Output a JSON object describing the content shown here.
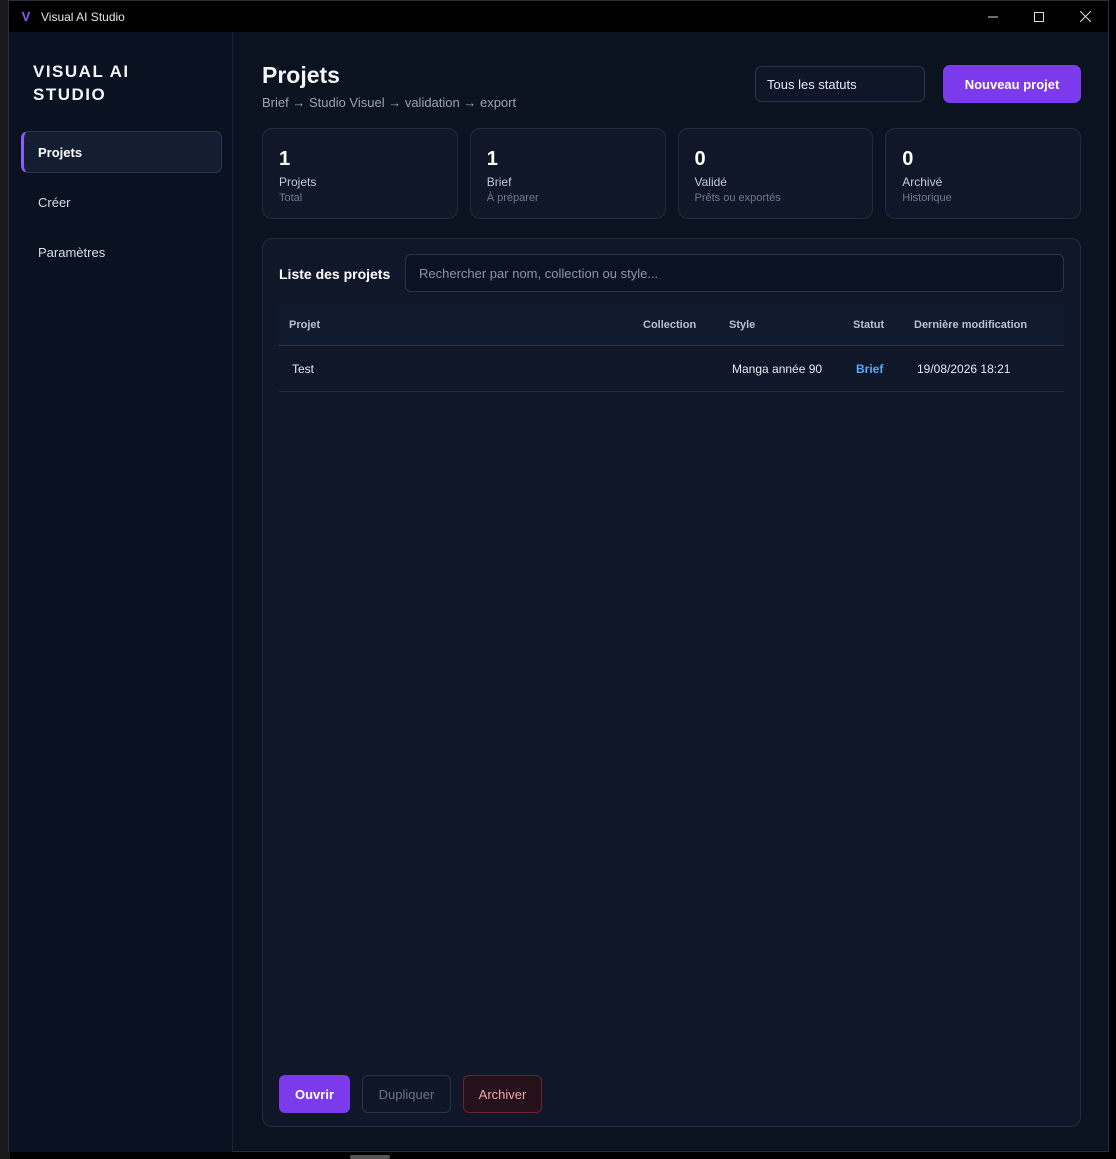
{
  "window": {
    "title": "Visual AI Studio",
    "app_icon": "V",
    "controls": [
      "minimize",
      "maximize",
      "close"
    ]
  },
  "sidebar": {
    "brand": "VISUAL AI STUDIO",
    "items": [
      {
        "label": "Projets",
        "active": true
      },
      {
        "label": "Créer",
        "active": false
      },
      {
        "label": "Paramètres",
        "active": false
      }
    ]
  },
  "header": {
    "title": "Projets",
    "subtitle": "Brief → Studio Visuel → validation → export",
    "status_filter": "Tous les statuts",
    "new_button": "Nouveau projet"
  },
  "stats": [
    {
      "value": "1",
      "label": "Projets",
      "hint": "Total"
    },
    {
      "value": "1",
      "label": "Brief",
      "hint": "À préparer"
    },
    {
      "value": "0",
      "label": "Validé",
      "hint": "Prêts ou exportés"
    },
    {
      "value": "0",
      "label": "Archivé",
      "hint": "Historique"
    }
  ],
  "projects_panel": {
    "title": "Liste des projets",
    "search_placeholder": "Rechercher par nom, collection ou style...",
    "columns": [
      "Projet",
      "Collection",
      "Style",
      "Statut",
      "Dernière modification"
    ],
    "rows": [
      {
        "project": "Test",
        "collection": "",
        "style": "Manga année 90",
        "status": "Brief",
        "modified": "19/08/2026 18:21"
      }
    ],
    "actions": {
      "open": "Ouvrir",
      "duplicate": "Dupliquer",
      "archive": "Archiver"
    }
  },
  "colors": {
    "accent": "#7c3aed",
    "background": "#0b1220",
    "status_brief": "#5aa8ff"
  }
}
